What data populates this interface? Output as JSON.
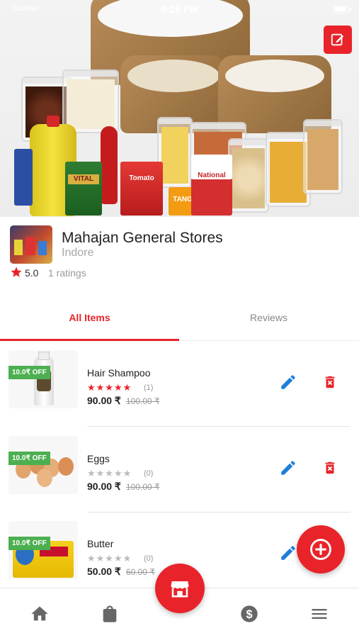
{
  "status_bar": {
    "carrier": "Carrier",
    "time": "6:26 PM"
  },
  "store": {
    "name": "Mahajan General Stores",
    "city": "Indore",
    "rating": "5.0",
    "ratings_count": "1 ratings"
  },
  "hero": {
    "product_labels": [
      "VITAL",
      "Tomato",
      "TANG",
      "National"
    ]
  },
  "tabs": [
    {
      "label": "All Items",
      "active": true
    },
    {
      "label": "Reviews",
      "active": false
    }
  ],
  "items": [
    {
      "discount": "10.0₹ OFF",
      "name": "Hair Shampoo",
      "rating": 5,
      "reviews": "(1)",
      "price": "90.00 ₹",
      "mrp": "100.00 ₹",
      "image": "shampoo-bottle"
    },
    {
      "discount": "10.0₹ OFF",
      "name": "Eggs",
      "rating": 0,
      "reviews": "(0)",
      "price": "90.00 ₹",
      "mrp": "100.00 ₹",
      "image": "eggs"
    },
    {
      "discount": "10.0₹ OFF",
      "name": "Butter",
      "rating": 0,
      "reviews": "(0)",
      "price": "50.00 ₹",
      "mrp": "60.00 ₹",
      "image": "butter-pack"
    }
  ],
  "colors": {
    "accent": "#e8242a",
    "discount_badge": "#4caf50",
    "edit_icon": "#1f7fd8"
  },
  "icons": [
    "edit-icon",
    "star-icon",
    "pencil-icon",
    "trash-icon",
    "add-circle-icon",
    "home-icon",
    "shopping-bag-icon",
    "store-icon",
    "dollar-icon",
    "menu-icon"
  ]
}
